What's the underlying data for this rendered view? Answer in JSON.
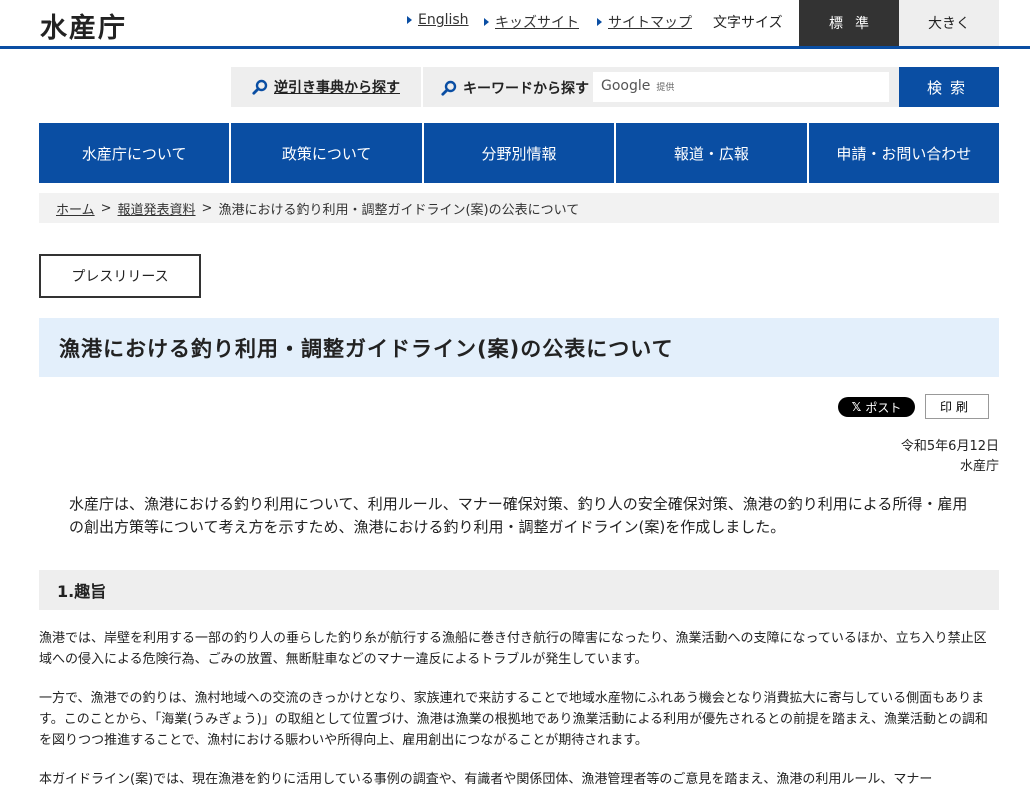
{
  "header": {
    "logo": "水産庁",
    "links": [
      "English",
      "キッズサイト",
      "サイトマップ"
    ],
    "font_size_label": "文字サイズ",
    "font_size_standard": "標準",
    "font_size_large": "大きく"
  },
  "search": {
    "reverse_dictionary": "逆引き事典から探す",
    "keyword_label": "キーワードから探す",
    "google": "Google",
    "provided": "提供",
    "button": "検索"
  },
  "nav": [
    "水産庁について",
    "政策について",
    "分野別情報",
    "報道・広報",
    "申請・お問い合わせ"
  ],
  "breadcrumb": {
    "home": "ホーム",
    "sep": ">",
    "press": "報道発表資料",
    "current": "漁港における釣り利用・調整ガイドライン(案)の公表について"
  },
  "tag": "プレスリリース",
  "title": "漁港における釣り利用・調整ガイドライン(案)の公表について",
  "share": {
    "x_post": "ポスト",
    "print": "印刷"
  },
  "date": "令和5年6月12日",
  "agency": "水産庁",
  "intro": "水産庁は、漁港における釣り利用について、利用ルール、マナー確保対策、釣り人の安全確保対策、漁港の釣り利用による所得・雇用の創出方策等について考え方を示すため、漁港における釣り利用・調整ガイドライン(案)を作成しました。",
  "section1": {
    "title": "1.趣旨",
    "paragraphs": [
      "漁港では、岸壁を利用する一部の釣り人の垂らした釣り糸が航行する漁船に巻き付き航行の障害になったり、漁業活動への支障になっているほか、立ち入り禁止区域への侵入による危険行為、ごみの放置、無断駐車などのマナー違反によるトラブルが発生しています。",
      "一方で、漁港での釣りは、漁村地域への交流のきっかけとなり、家族連れで来訪することで地域水産物にふれあう機会となり消費拡大に寄与している側面もあります。このことから、「海業(うみぎょう)」の取組として位置づけ、漁港は漁業の根拠地であり漁業活動による利用が優先されるとの前提を踏まえ、漁業活動との調和を図りつつ推進することで、漁村における賑わいや所得向上、雇用創出につながることが期待されます。",
      "本ガイドライン(案)では、現在漁港を釣りに活用している事例の調査や、有識者や関係団体、漁港管理者等のご意見を踏まえ、漁港の利用ルール、マナー"
    ]
  }
}
